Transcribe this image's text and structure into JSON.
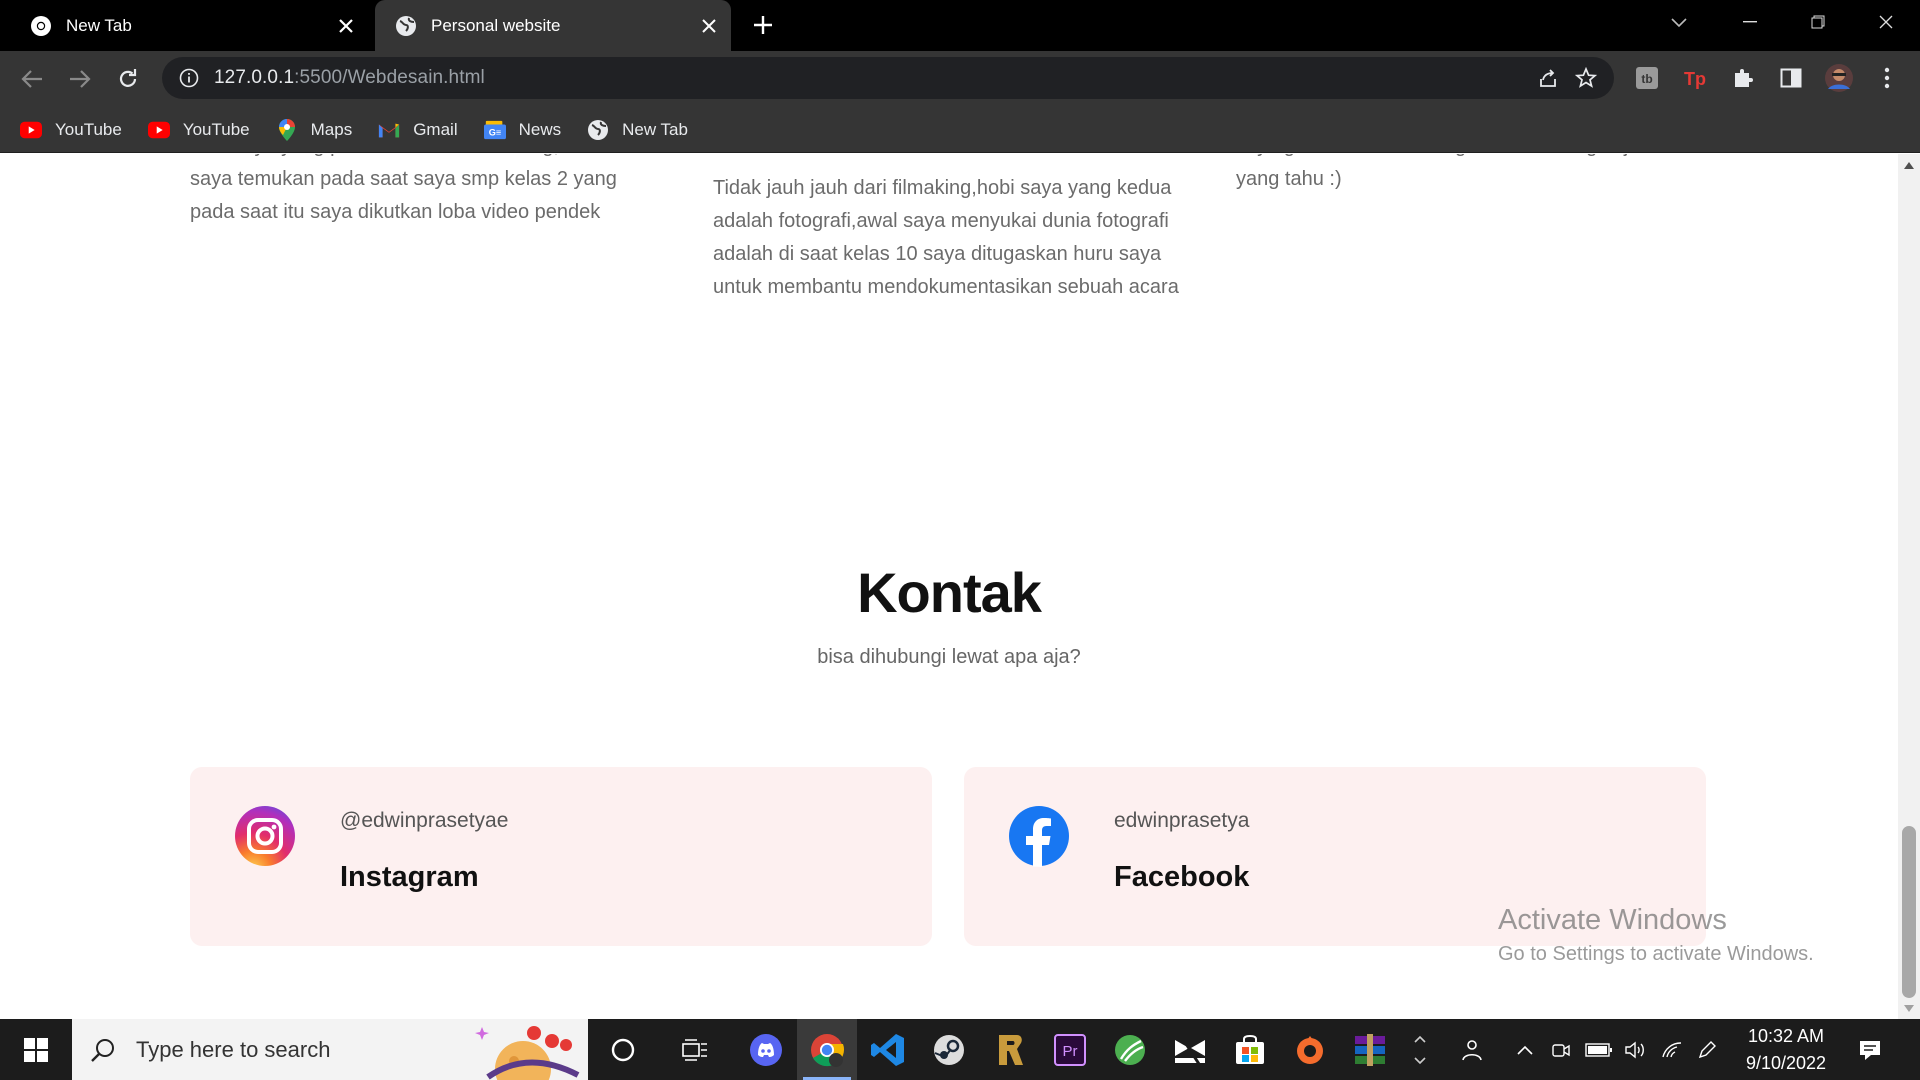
{
  "browser": {
    "tabs": [
      {
        "title": "New Tab",
        "active": false
      },
      {
        "title": "Personal website",
        "active": true
      }
    ],
    "url_host": "127.0.0.1",
    "url_path": ":5500/Webdesain.html",
    "bookmarks": [
      {
        "label": "YouTube",
        "icon": "youtube-icon"
      },
      {
        "label": "YouTube",
        "icon": "youtube-icon"
      },
      {
        "label": "Maps",
        "icon": "maps-icon"
      },
      {
        "label": "Gmail",
        "icon": "gmail-icon"
      },
      {
        "label": "News",
        "icon": "news-icon"
      },
      {
        "label": "New Tab",
        "icon": "globe-icon"
      }
    ]
  },
  "page": {
    "hobbies": [
      {
        "text": "hobi saya yang pertama adalah filmaking,hobi ini saya temukan pada saat saya smp kelas 2 yang pada saat itu saya dikutkan loba video pendek"
      },
      {
        "text": "Tidak jauh jauh dari filmaking,hobi saya yang kedua adalah fotografi,awal saya menyukai dunia fotografi adalah di saat kelas 10 saya ditugaskan huru saya untuk membantu mendokumentasikan sebuah acara"
      },
      {
        "text": "saya game sekedar mengisi waktu luang saja sih yang tahu :)"
      }
    ],
    "kontak": {
      "title": "Kontak",
      "subtitle": "bisa dihubungi lewat apa aja?",
      "cards": [
        {
          "handle": "@edwinprasetyae",
          "platform": "Instagram",
          "icon": "instagram-icon"
        },
        {
          "handle": "edwinprasetya",
          "platform": "Facebook",
          "icon": "facebook-icon"
        }
      ]
    },
    "watermark": {
      "line1": "Activate Windows",
      "line2": "Go to Settings to activate Windows."
    }
  },
  "taskbar": {
    "search_placeholder": "Type here to search",
    "time": "10:32 AM",
    "date": "9/10/2022",
    "apps": [
      "cortana-icon",
      "task-view-icon",
      "discord-icon",
      "chrome-icon",
      "vscode-icon",
      "steam-icon",
      "riot-icon",
      "premiere-icon",
      "greenshot-icon",
      "capcut-icon",
      "store-icon",
      "origin-icon",
      "winrar-icon"
    ]
  },
  "colors": {
    "card_bg": "#fdf0f0",
    "browser_dark": "#353535",
    "accent": "#1877f2"
  }
}
